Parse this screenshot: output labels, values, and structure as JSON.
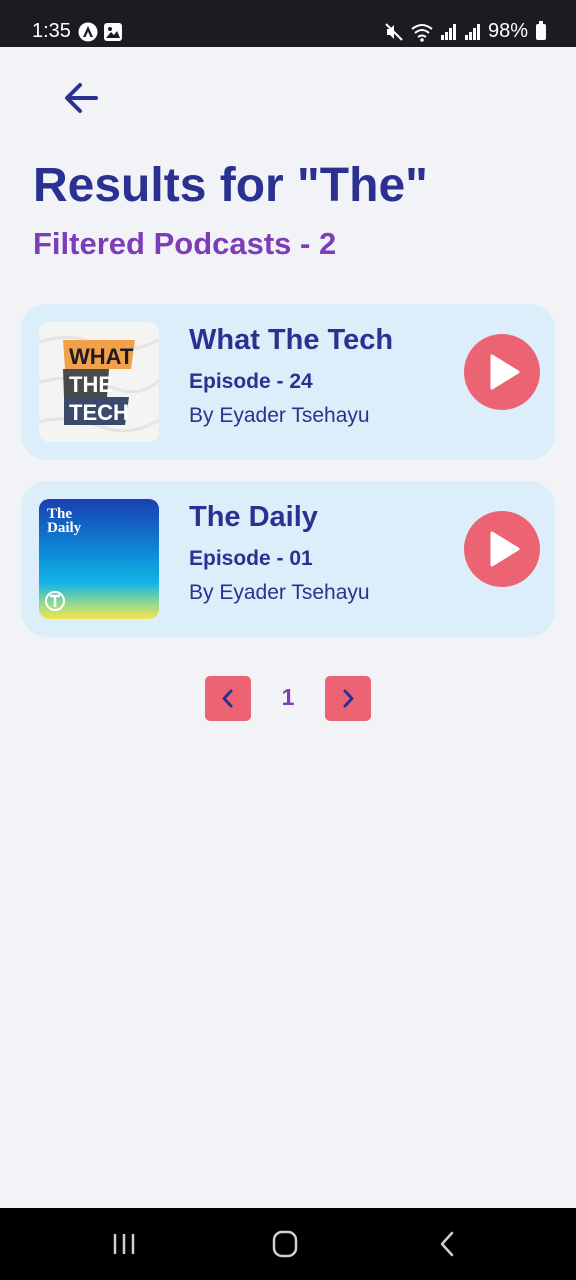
{
  "status_bar": {
    "time": "1:35",
    "battery": "98%"
  },
  "header": {
    "title": "Results for \"The\"",
    "subtitle": "Filtered Podcasts - 2"
  },
  "podcasts": [
    {
      "title": "What The Tech",
      "episode": "Episode - 24",
      "author": "By Eyader Tsehayu",
      "cover_lines": [
        "WHAT",
        "THE",
        "TECH"
      ]
    },
    {
      "title": "The Daily",
      "episode": "Episode - 01",
      "author": "By Eyader Tsehayu",
      "cover_lines": [
        "The",
        "Daily"
      ]
    }
  ],
  "pagination": {
    "current_page": "1"
  },
  "icons": {
    "back": "arrow-left-icon",
    "play": "play-icon",
    "prev": "chevron-left-icon",
    "next": "chevron-right-icon"
  },
  "colors": {
    "accent": "#ec6474",
    "title": "#2b3190",
    "subtitle": "#7d3cb8",
    "card": "#dceefa",
    "background": "#f2f3f7"
  }
}
